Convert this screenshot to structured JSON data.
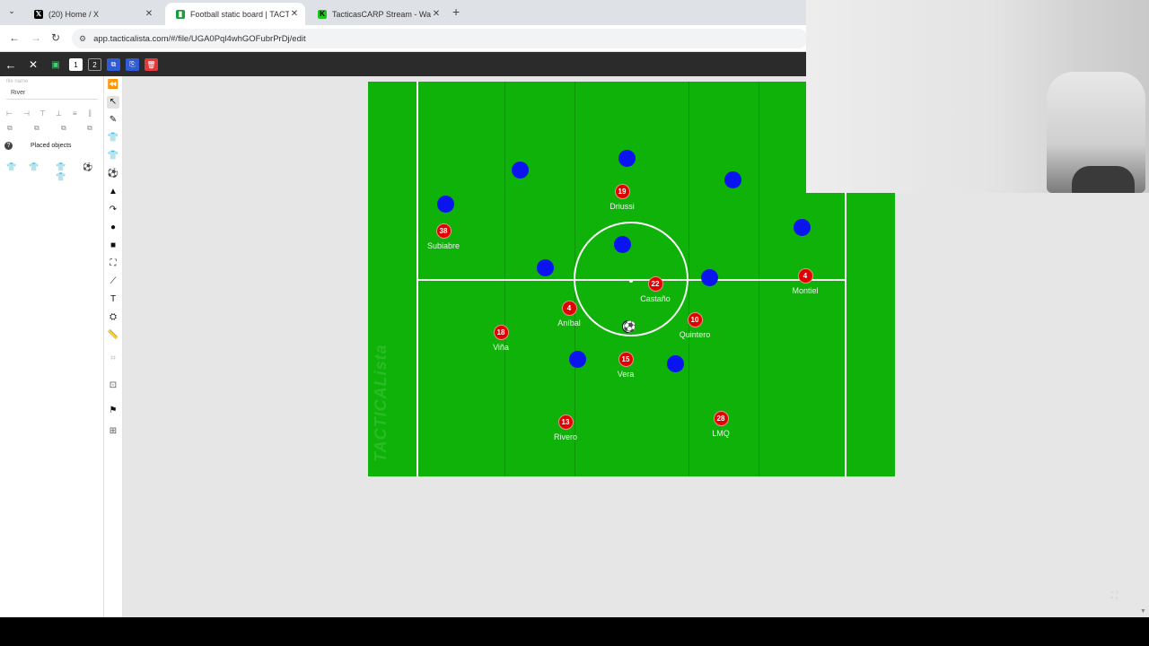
{
  "browser": {
    "tabs": [
      {
        "title": "(20) Home / X",
        "icon": "x-logo-icon",
        "active": false
      },
      {
        "title": "Football static board | TACTICA",
        "icon": "tacticalista-icon",
        "active": true
      },
      {
        "title": "TacticasCARP Stream - Watch L",
        "icon": "kick-logo-icon",
        "active": false
      }
    ],
    "url": "app.tacticalista.com/#/file/UGA0Pql4whGOFubrPrDj/edit"
  },
  "toolbar": {
    "slide_1": "1",
    "slide_2": "2"
  },
  "left_panel": {
    "file_name_label": "file name",
    "file_name_value": "River",
    "placed_objects_label": "Placed objects"
  },
  "board": {
    "watermark": "TACTICALista",
    "red_team": [
      {
        "number": "38",
        "name": "Subiabre"
      },
      {
        "number": "19",
        "name": "Driussi"
      },
      {
        "number": "22",
        "name": "Castaño"
      },
      {
        "number": "4",
        "name": "Montiel"
      },
      {
        "number": "4",
        "name": "Aníbal"
      },
      {
        "number": "10",
        "name": "Quintero"
      },
      {
        "number": "18",
        "name": "Viña"
      },
      {
        "number": "15",
        "name": "Vera"
      },
      {
        "number": "13",
        "name": "Rivero"
      },
      {
        "number": "28",
        "name": "LMQ"
      }
    ],
    "blue_team_count": 11,
    "colors": {
      "pitch": "#0eb208",
      "red_team": "#e00000",
      "blue_team": "#0a14ee"
    }
  }
}
